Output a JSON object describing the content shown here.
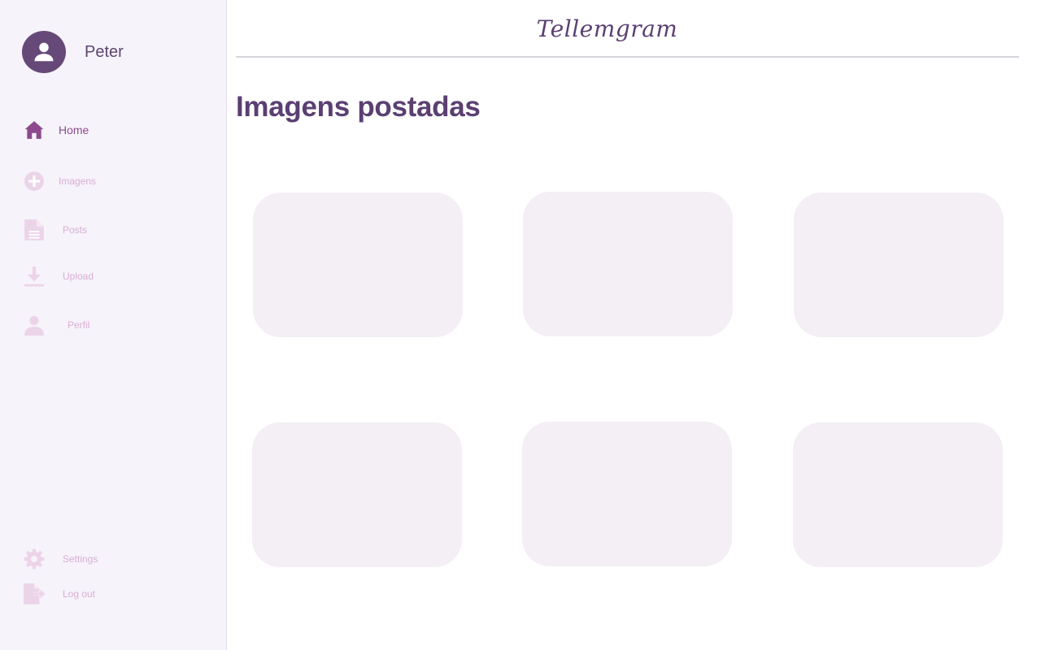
{
  "sidebar": {
    "username": "Peter",
    "nav": [
      {
        "label": "Home",
        "icon": "home-icon",
        "active": true
      },
      {
        "label": "Imagens",
        "icon": "add-circle-icon",
        "active": false
      },
      {
        "label": "Posts",
        "icon": "document-icon",
        "active": false
      },
      {
        "label": "Upload",
        "icon": "download-icon",
        "active": false
      },
      {
        "label": "Perfil",
        "icon": "person-icon",
        "active": false
      }
    ],
    "footer": [
      {
        "label": "Settings",
        "icon": "gear-icon"
      },
      {
        "label": "Log out",
        "icon": "logout-icon"
      }
    ]
  },
  "header": {
    "brand": "Tellemgram"
  },
  "main": {
    "title": "Imagens postadas",
    "card_count": 6
  },
  "colors": {
    "accent": "#5b3f72",
    "avatar_bg": "#664978",
    "active_nav": "#8c4a8d",
    "inactive_nav": "#d9aed3",
    "sidebar_bg": "#f6f3fa",
    "card_bg": "#f4eef5"
  }
}
